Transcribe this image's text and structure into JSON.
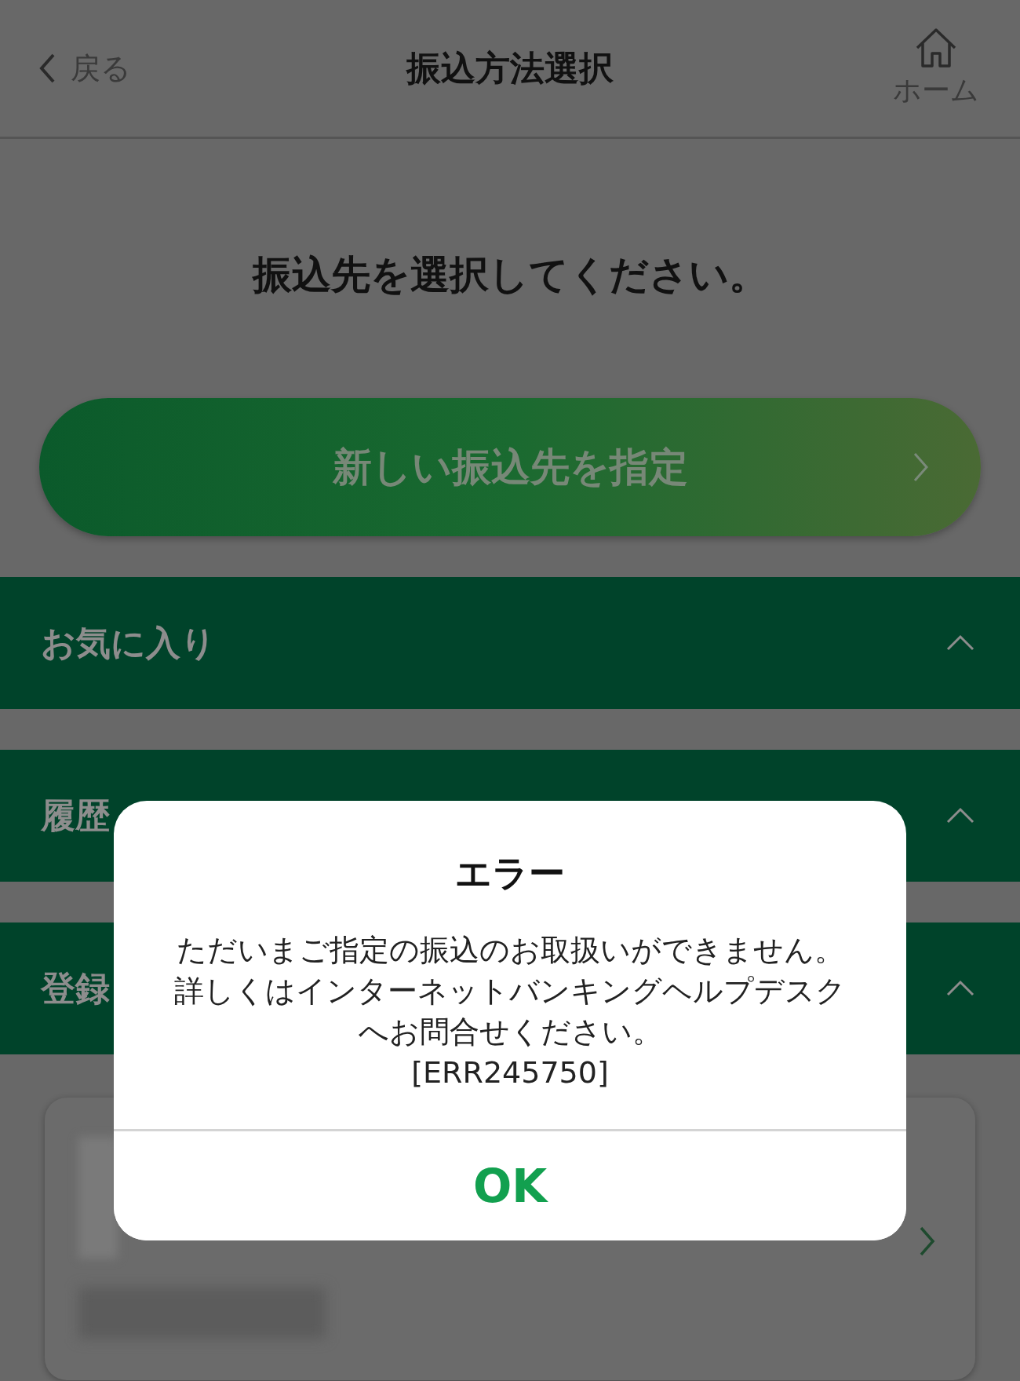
{
  "header": {
    "back_label": "戻る",
    "title": "振込方法選択",
    "home_label": "ホーム"
  },
  "prompt": "振込先を選択してください。",
  "new_payee_button": {
    "label": "新しい振込先を指定"
  },
  "sections": [
    {
      "label": "お気に入り",
      "expanded": true
    },
    {
      "label": "履歴",
      "expanded": true
    },
    {
      "label": "登録",
      "expanded": true
    }
  ],
  "dialog": {
    "title": "エラー",
    "message": "ただいまご指定の振込のお取扱いができません。詳しくはインターネットバンキングヘルプデスクへお問合せください。",
    "code": "[ERR245750]",
    "button": "OK"
  }
}
